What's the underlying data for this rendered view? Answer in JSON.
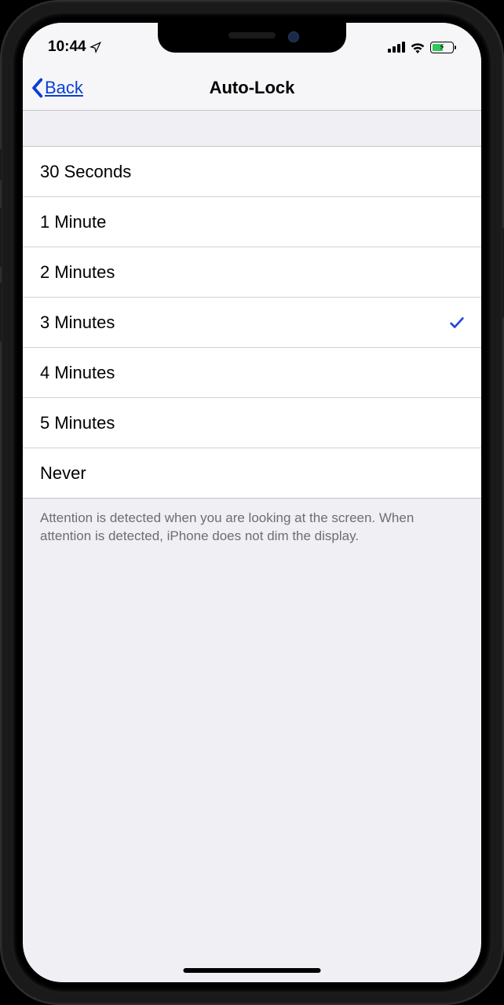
{
  "statusBar": {
    "time": "10:44"
  },
  "nav": {
    "backLabel": "Back",
    "title": "Auto-Lock"
  },
  "options": [
    {
      "label": "30 Seconds",
      "selected": false
    },
    {
      "label": "1 Minute",
      "selected": false
    },
    {
      "label": "2 Minutes",
      "selected": false
    },
    {
      "label": "3 Minutes",
      "selected": true
    },
    {
      "label": "4 Minutes",
      "selected": false
    },
    {
      "label": "5 Minutes",
      "selected": false
    },
    {
      "label": "Never",
      "selected": false
    }
  ],
  "footer": {
    "text": "Attention is detected when you are looking at the screen. When attention is detected, iPhone does not dim the display."
  }
}
